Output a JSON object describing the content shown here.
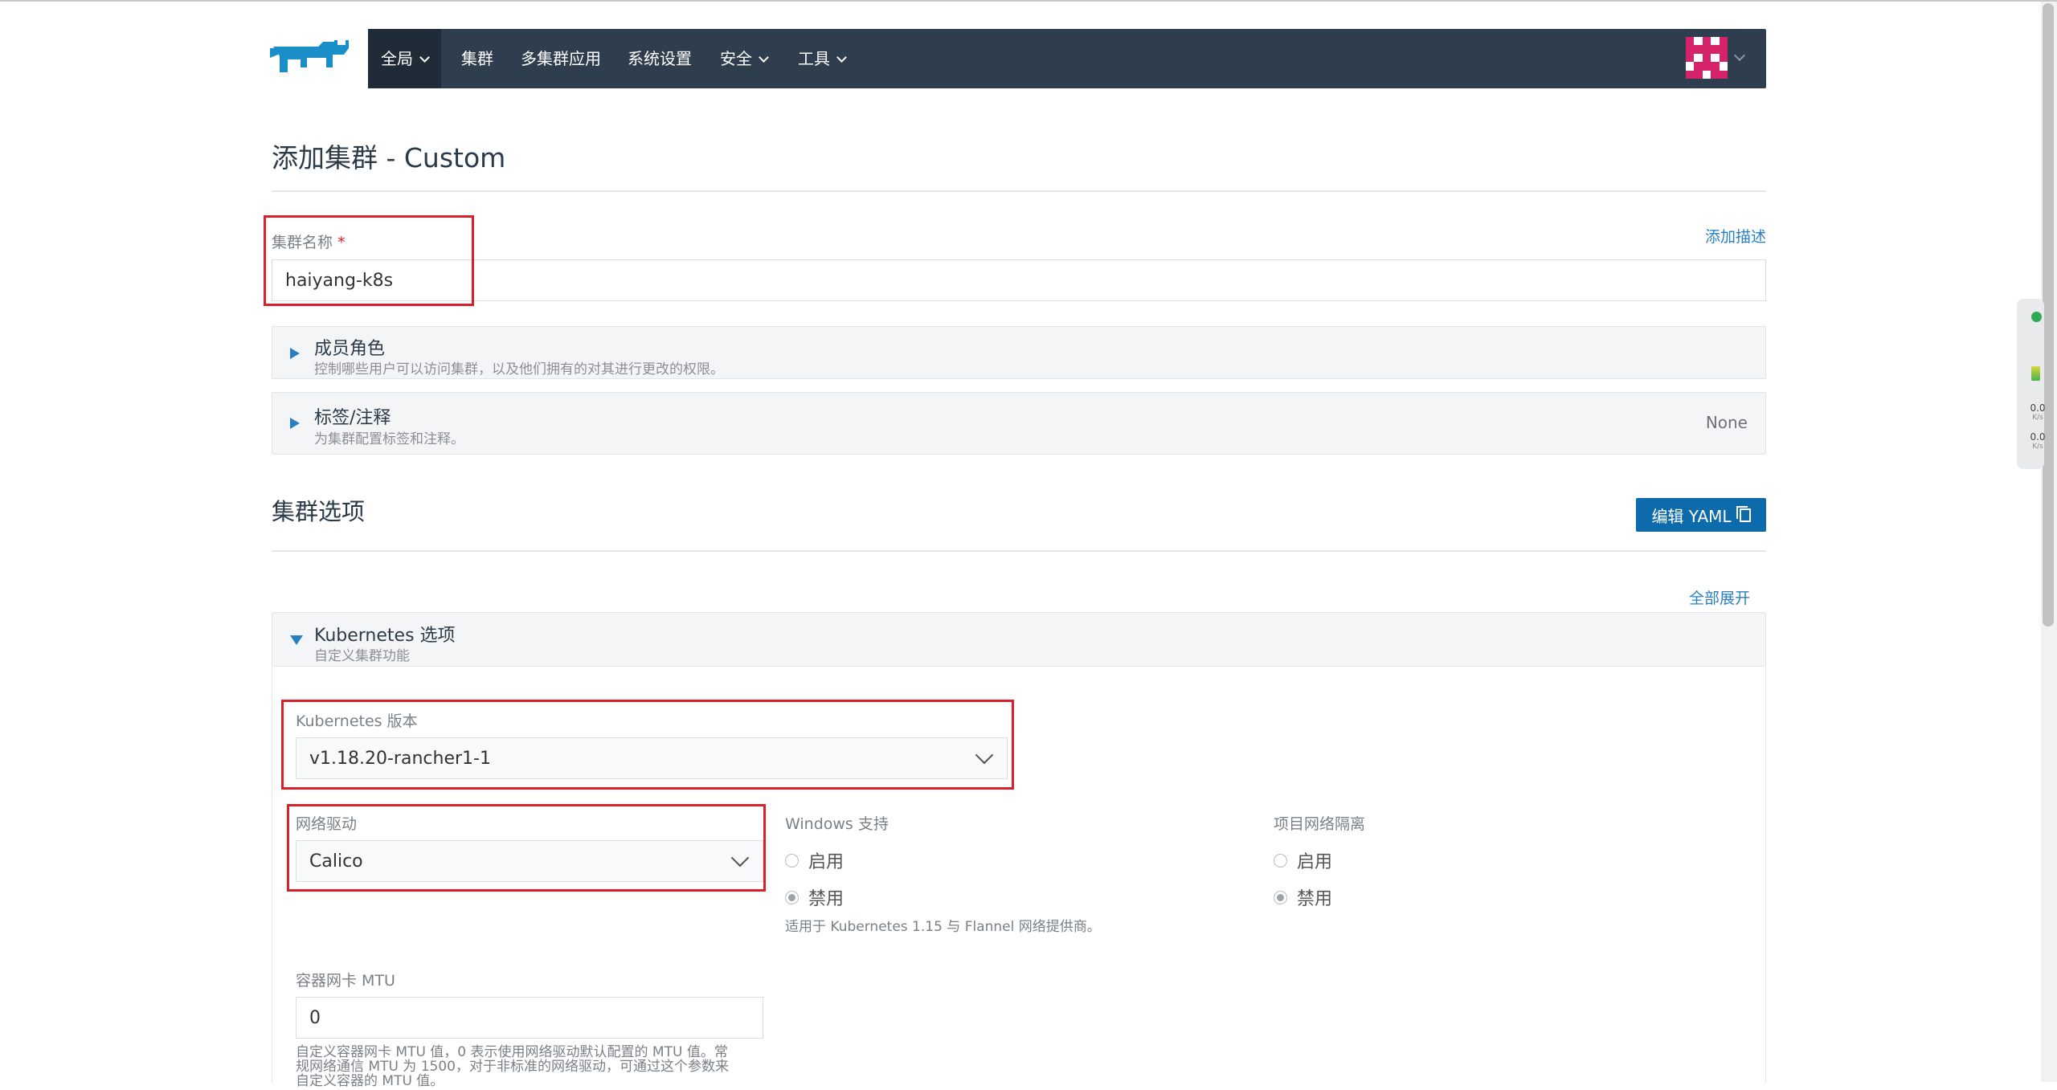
{
  "nav": {
    "items": [
      {
        "label": "全局",
        "dropdown": true
      },
      {
        "label": "集群",
        "dropdown": false
      },
      {
        "label": "多集群应用",
        "dropdown": false
      },
      {
        "label": "系统设置",
        "dropdown": false
      },
      {
        "label": "安全",
        "dropdown": true
      },
      {
        "label": "工具",
        "dropdown": true
      }
    ],
    "logo_icon": "rancher-cow-logo-icon",
    "avatar_icon": "identicon-avatar"
  },
  "page": {
    "title": "添加集群 - Custom"
  },
  "cluster_name": {
    "label": "集群名称",
    "required_mark": "*",
    "value": "haiyang-k8s",
    "add_description": "添加描述"
  },
  "members": {
    "title": "成员角色",
    "subtitle": "控制哪些用户可以访问集群，以及他们拥有的对其进行更改的权限。"
  },
  "labels": {
    "title": "标签/注释",
    "subtitle": "为集群配置标签和注释。",
    "value": "None"
  },
  "cluster_options": {
    "title": "集群选项",
    "edit_yaml": "编辑 YAML",
    "expand_all": "全部展开"
  },
  "kubernetes": {
    "title": "Kubernetes 选项",
    "subtitle": "自定义集群功能",
    "version_label": "Kubernetes 版本",
    "version_value": "v1.18.20-rancher1-1",
    "network_label": "网络驱动",
    "network_value": "Calico",
    "windows_label": "Windows 支持",
    "windows_enable": "启用",
    "windows_disable": "禁用",
    "windows_help": "适用于 Kubernetes 1.15 与 Flannel 网络提供商。",
    "isolation_label": "项目网络隔离",
    "isolation_enable": "启用",
    "isolation_disable": "禁用",
    "mtu_label": "容器网卡 MTU",
    "mtu_value": "0",
    "mtu_help_1": "自定义容器网卡 MTU 值，0 表示使用网络驱动默认配置的 MTU 值。常",
    "mtu_help_2": "规网络通信 MTU 为 1500，对于非标准的网络驱动，可通过这个参数来",
    "mtu_help_3": "自定义容器的 MTU 值。"
  },
  "side_widget": {
    "up_value": "0.0",
    "up_unit": "K/s",
    "down_value": "0.0",
    "down_unit": "K/s"
  },
  "colors": {
    "nav_bg": "#2f3e4e",
    "accent": "#2a7fc1",
    "button": "#0e6bab",
    "highlight_box": "#d8212a"
  }
}
